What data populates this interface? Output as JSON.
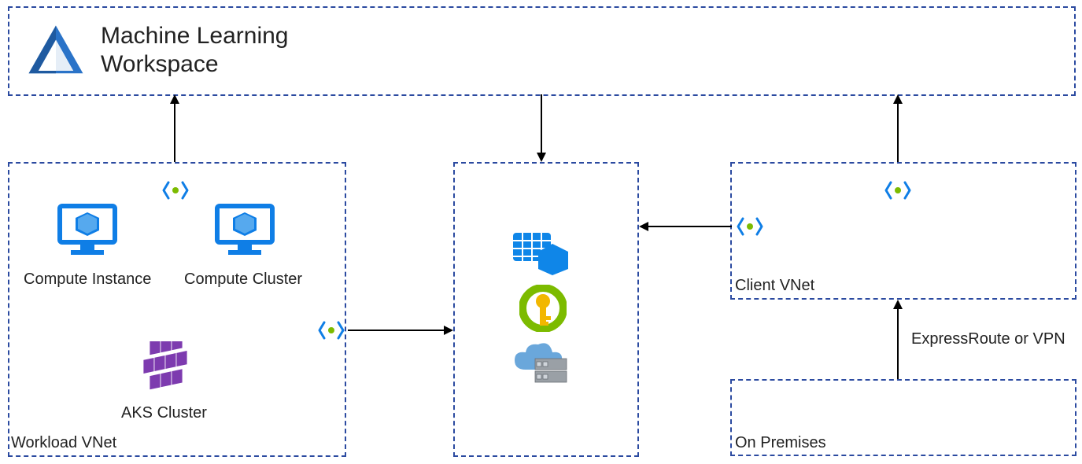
{
  "workspace": {
    "title_line1": "Machine Learning",
    "title_line2": "Workspace"
  },
  "workload_vnet": {
    "label": "Workload VNet",
    "compute_instance": "Compute Instance",
    "compute_cluster": "Compute Cluster",
    "aks_cluster": "AKS Cluster"
  },
  "client_vnet": {
    "label": "Client VNet"
  },
  "on_premises": {
    "label": "On Premises"
  },
  "connection": {
    "expressroute": "ExpressRoute or VPN"
  },
  "icons": {
    "ml_workspace": "azure-ml-icon",
    "private_endpoint": "private-endpoint-icon",
    "compute": "vm-icon",
    "aks": "kubernetes-icon",
    "storage": "storage-icon",
    "keyvault": "keyvault-icon",
    "container_registry": "container-registry-icon"
  }
}
